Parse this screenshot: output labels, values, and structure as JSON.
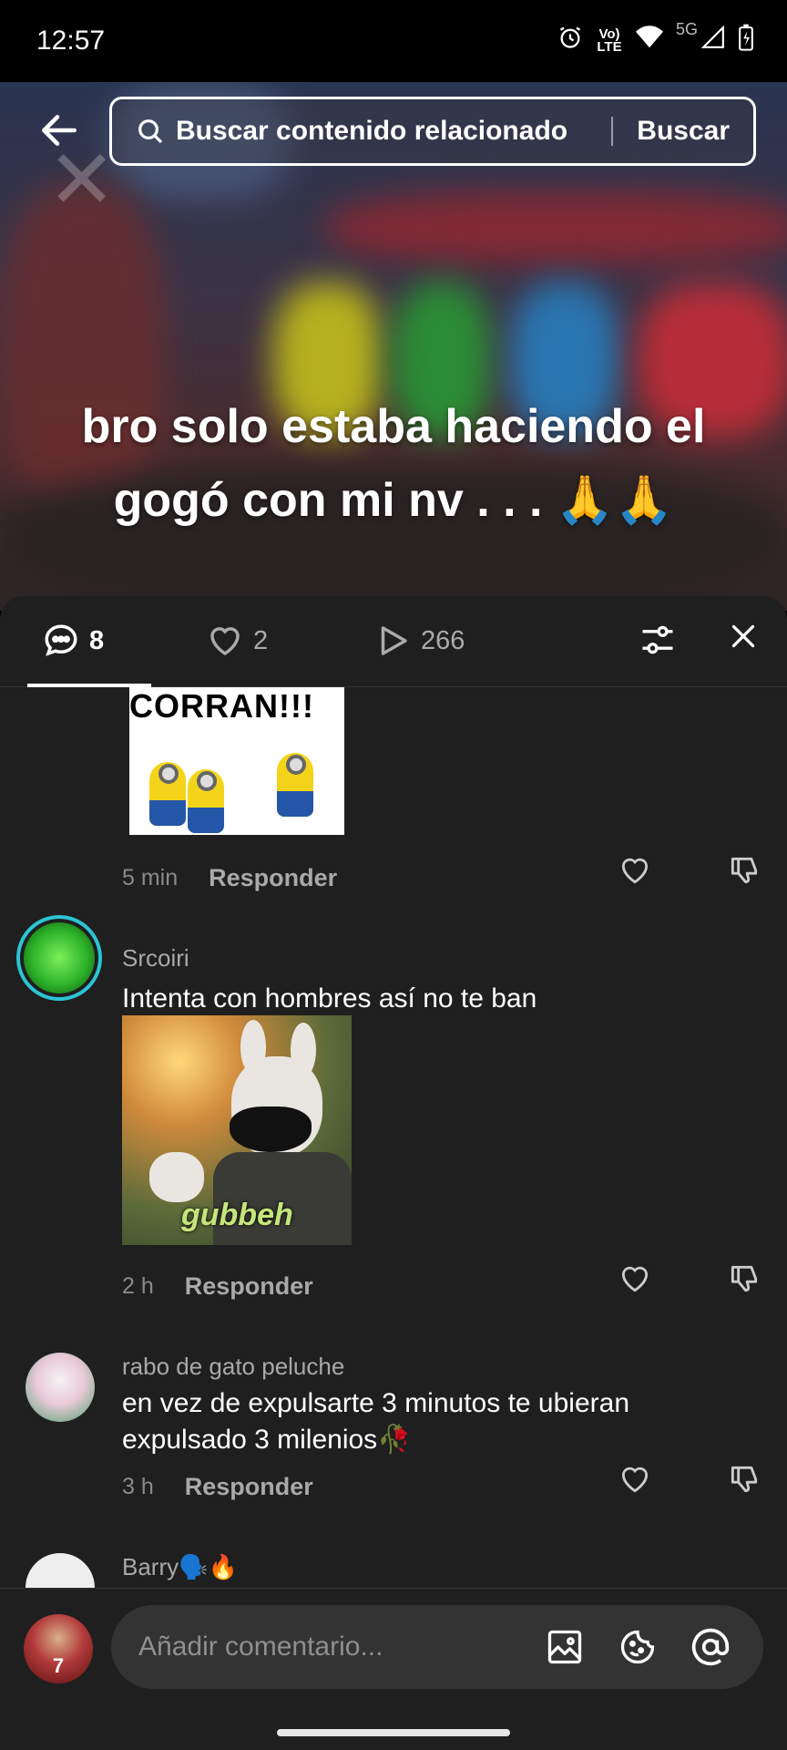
{
  "status_bar": {
    "time": "12:57",
    "network": "5G",
    "volte": "Vo) LTE"
  },
  "video": {
    "caption_line1": "bro solo estaba haciendo el",
    "caption_line2": "gogó con mi nv . . . 🙏🙏"
  },
  "search": {
    "placeholder": "Buscar contenido relacionado",
    "button": "Buscar"
  },
  "tabs": {
    "comments_count": "8",
    "likes_count": "2",
    "plays_count": "266"
  },
  "comments": [
    {
      "image_text": "CORRAN!!!",
      "time": "5 min",
      "reply": "Responder"
    },
    {
      "username": "Srcoiri",
      "text": "Intenta con hombres así no te ban",
      "image_watermark": "gubbeh",
      "time": "2 h",
      "reply": "Responder"
    },
    {
      "username": "rabo de gato peluche",
      "text": "en vez de expulsarte 3 minutos te ubieran expulsado 3 milenios🥀",
      "time": "3 h",
      "reply": "Responder"
    },
    {
      "username": "Barry🗣️🔥",
      "text": ""
    }
  ],
  "composer": {
    "placeholder": "Añadir comentario...",
    "avatar_number": "7"
  },
  "icons": [
    "back-arrow-icon",
    "search-icon",
    "comment-icon",
    "heart-icon",
    "play-icon",
    "filter-icon",
    "close-icon",
    "dislike-icon",
    "image-icon",
    "sticker-icon",
    "mention-icon"
  ],
  "colors": {
    "sheet_bg": "#1f1f1f",
    "input_bg": "#333333",
    "avatar_ring": "#2bc4d4"
  }
}
